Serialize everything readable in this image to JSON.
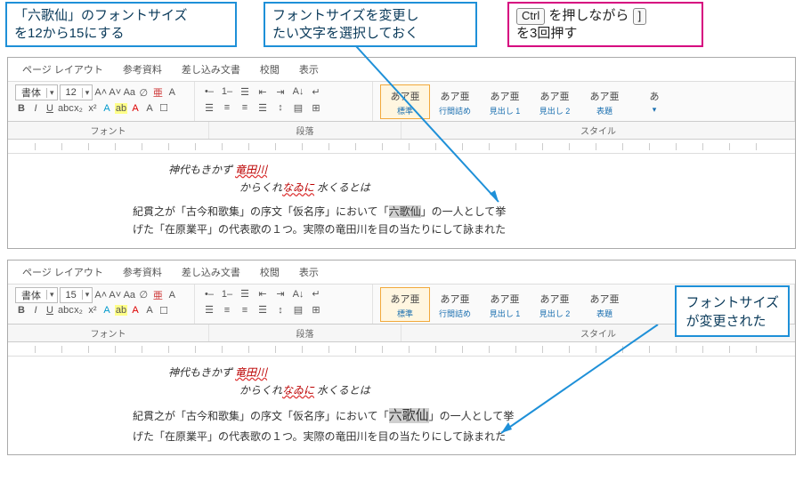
{
  "annotations": {
    "a1_l1": "「六歌仙」のフォントサイズ",
    "a1_l2": "を12から15にする",
    "a2_l1": "フォントサイズを変更し",
    "a2_l2": "たい文字を選択しておく",
    "a3_pre": "",
    "a3_ctrl": "Ctrl",
    "a3_mid": "を押しながら",
    "a3_key": "]",
    "a3_l2": "を3回押す",
    "a4_l1": "フォントサイズ",
    "a4_l2": "が変更された"
  },
  "ribbon": {
    "tabs": {
      "t1": "ページ レイアウト",
      "t2": "参考資料",
      "t3": "差し込み文書",
      "t4": "校閲",
      "t5": "表示"
    },
    "font_name": "書体",
    "size_before": "12",
    "size_after": "15",
    "group_font": "フォント",
    "group_para": "段落",
    "group_style": "スタイル",
    "style_preview": "あア亜",
    "style1": "標準",
    "style2": "行間詰め",
    "style3": "見出し 1",
    "style4": "見出し 2",
    "style5": "表題",
    "style_preview5": "あア亜"
  },
  "doc": {
    "line1a": "神代もきかず ",
    "line1b": "竜田川",
    "line2a": "からくれ",
    "line2b": "なゐに",
    "line2c": " 水くるとは",
    "body1a": "紀貫之が「古今和歌集」の序文「仮名序」において「",
    "sel": "六歌仙",
    "body1b": "」の一人として挙",
    "body2": "げた「在原業平」の代表歌の１つ。実際の竜田川を目の当たりにして詠まれた"
  }
}
